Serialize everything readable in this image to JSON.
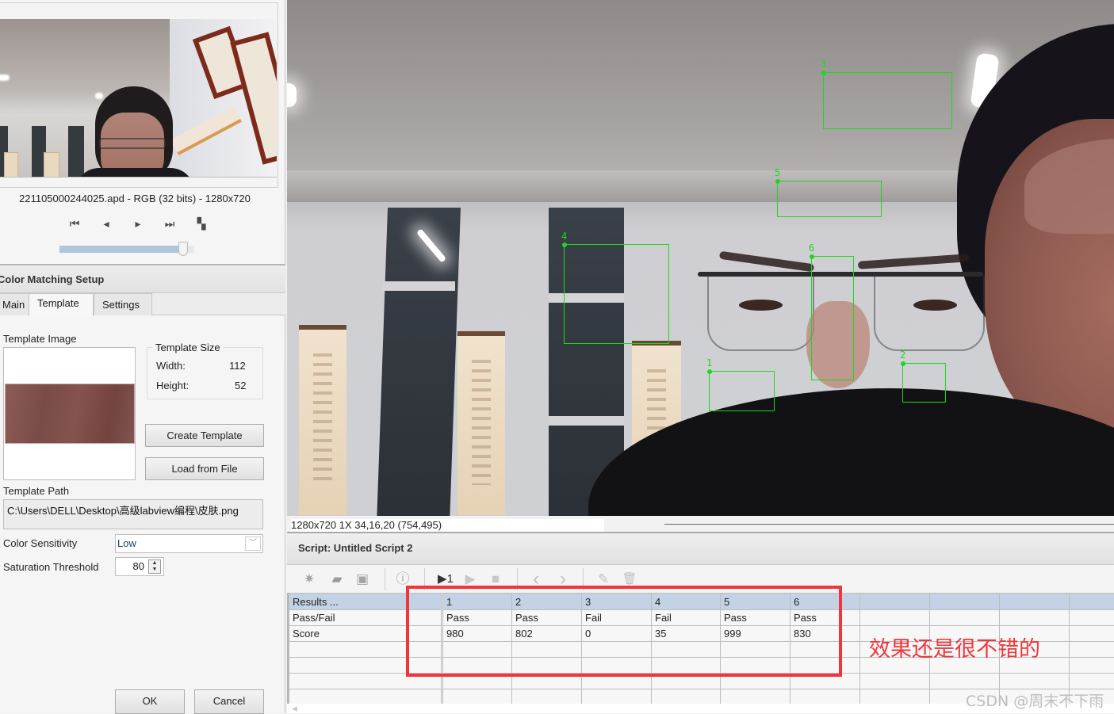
{
  "thumbnail": {
    "file_info": "221105000244025.apd - RGB (32 bits) - 1280x720",
    "nav": [
      {
        "icon": "first-frame-icon",
        "glyph": "⏮"
      },
      {
        "icon": "previous-frame-icon",
        "glyph": "◂"
      },
      {
        "icon": "next-frame-icon",
        "glyph": "▸"
      },
      {
        "icon": "last-frame-icon",
        "glyph": "⏭"
      },
      {
        "icon": "window-mode-icon",
        "glyph": "▚"
      }
    ],
    "slider_fraction": 0.95
  },
  "setup": {
    "title": "Color Matching Setup",
    "tabs": [
      {
        "label": "Main",
        "active": false
      },
      {
        "label": "Template",
        "active": true
      },
      {
        "label": "Settings",
        "active": false
      }
    ],
    "template_image_label": "Template Image",
    "template_size": {
      "legend": "Template Size",
      "width_label": "Width:",
      "width_value": "112",
      "height_label": "Height:",
      "height_value": "52"
    },
    "create_template_label": "Create Template",
    "load_from_file_label": "Load from File",
    "template_path_label": "Template Path",
    "template_path_value": "C:\\Users\\DELL\\Desktop\\高级labview编程\\皮肤.png",
    "color_sensitivity_label": "Color Sensitivity",
    "color_sensitivity_value": "Low",
    "saturation_threshold_label": "Saturation Threshold",
    "saturation_threshold_value": "80",
    "ok_label": "OK",
    "cancel_label": "Cancel"
  },
  "viewer": {
    "rois": [
      {
        "id": "1"
      },
      {
        "id": "2"
      },
      {
        "id": "3"
      },
      {
        "id": "4"
      },
      {
        "id": "5"
      },
      {
        "id": "6"
      }
    ],
    "status_text": "1280x720 1X 34,16,20    (754,495)"
  },
  "script": {
    "title": "Script: Untitled Script 2",
    "toolbar": [
      {
        "icon": "new-script-icon",
        "glyph": "✷"
      },
      {
        "icon": "open-folder-icon",
        "glyph": "▰"
      },
      {
        "icon": "save-icon",
        "glyph": "▣"
      },
      {
        "icon": "info-icon",
        "glyph": "ⓘ"
      },
      {
        "icon": "run-once-icon",
        "glyph": "▶1"
      },
      {
        "icon": "run-icon",
        "glyph": "▶"
      },
      {
        "icon": "stop-icon",
        "glyph": "■"
      },
      {
        "icon": "step-back-icon",
        "glyph": "‹"
      },
      {
        "icon": "step-forward-icon",
        "glyph": "›"
      },
      {
        "icon": "edit-icon",
        "glyph": "✎"
      },
      {
        "icon": "delete-icon",
        "glyph": "🗑"
      }
    ]
  },
  "results": {
    "header_label": "Results ...",
    "columns": [
      "1",
      "2",
      "3",
      "4",
      "5",
      "6",
      "",
      "",
      "",
      ""
    ],
    "rows": [
      {
        "label": "Pass/Fail",
        "values": [
          "Pass",
          "Pass",
          "Fail",
          "Fail",
          "Pass",
          "Pass",
          "",
          "",
          "",
          ""
        ]
      },
      {
        "label": "Score",
        "values": [
          "980",
          "802",
          "0",
          "35",
          "999",
          "830",
          "",
          "",
          "",
          ""
        ]
      },
      {
        "label": "",
        "values": [
          "",
          "",
          "",
          "",
          "",
          "",
          "",
          "",
          "",
          ""
        ]
      },
      {
        "label": "",
        "values": [
          "",
          "",
          "",
          "",
          "",
          "",
          "",
          "",
          "",
          ""
        ]
      },
      {
        "label": "",
        "values": [
          "",
          "",
          "",
          "",
          "",
          "",
          "",
          "",
          "",
          ""
        ]
      },
      {
        "label": "",
        "values": [
          "",
          "",
          "",
          "",
          "",
          "",
          "",
          "",
          "",
          ""
        ]
      }
    ]
  },
  "annotation": {
    "text": "效果还是很不错的",
    "color": "#f2353a"
  },
  "watermark": "CSDN @周末不下雨",
  "colors": {
    "roi_green": "#1cd81c",
    "table_header": "#c3d3e5",
    "slider_fill": "#aec6dd"
  }
}
